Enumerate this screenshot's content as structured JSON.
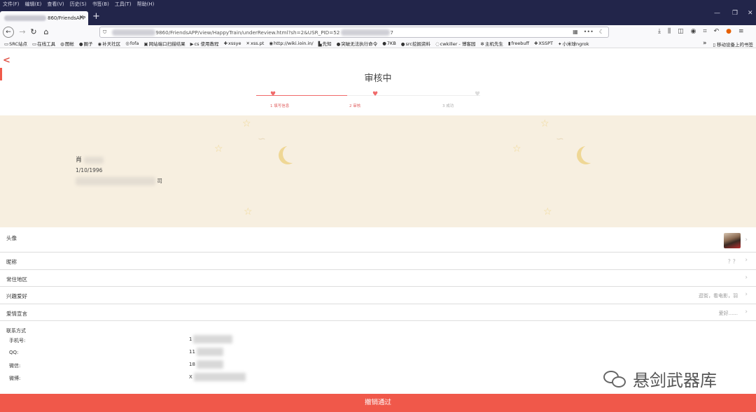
{
  "browser": {
    "menu": [
      "文件(F)",
      "编辑(E)",
      "查看(V)",
      "历史(S)",
      "书签(B)",
      "工具(T)",
      "帮助(H)"
    ],
    "tab_title": "860/FriendsAPP",
    "tab_close": "×",
    "new_tab": "+",
    "url_visible": "9860/FriendsAPP/view/HappyTrain/underReview.html?sh=2&USR_PID=52",
    "url_tail": "7",
    "bookmarks": [
      {
        "icon": "folder-icon",
        "glyph": "▭",
        "label": "SRC站点"
      },
      {
        "icon": "folder-icon",
        "glyph": "▭",
        "label": "在线工具"
      },
      {
        "icon": "globe-icon",
        "glyph": "◍",
        "label": "图帐"
      },
      {
        "icon": "site-icon",
        "glyph": "●",
        "label": "圈子"
      },
      {
        "icon": "site-icon",
        "glyph": "◉",
        "label": "补天社区"
      },
      {
        "icon": "site-icon",
        "glyph": "◎",
        "label": "fofa"
      },
      {
        "icon": "bookmark-icon",
        "glyph": "▣",
        "label": "网站端口扫描结果"
      },
      {
        "icon": "play-icon",
        "glyph": "▶",
        "label": "cs 使用教程"
      },
      {
        "icon": "bookmark-icon",
        "glyph": "✚",
        "label": "xssye"
      },
      {
        "icon": "bookmark-icon",
        "glyph": "✕",
        "label": "xss.pt"
      },
      {
        "icon": "site-icon",
        "glyph": "◉",
        "label": "http://wiki.ioin.in/"
      },
      {
        "icon": "site-icon",
        "glyph": "▙",
        "label": "先知"
      },
      {
        "icon": "github-icon",
        "glyph": "●",
        "label": "突破无法执行命令"
      },
      {
        "icon": "github-icon",
        "glyph": "●",
        "label": "7KB"
      },
      {
        "icon": "github-icon",
        "glyph": "●",
        "label": "src挖掘资料"
      },
      {
        "icon": "site-icon",
        "glyph": "◌",
        "label": "cwkiller - 博客园"
      },
      {
        "icon": "site-icon",
        "glyph": "✻",
        "label": "主机先生"
      },
      {
        "icon": "site-icon",
        "glyph": "▮",
        "label": "freebuff"
      },
      {
        "icon": "bookmark-icon",
        "glyph": "✚",
        "label": "XSSPT"
      },
      {
        "icon": "site-icon",
        "glyph": "✦",
        "label": "小米球ngrok"
      }
    ],
    "bookmarks_overflow": "»",
    "mobile_bookmarks": "▯ 移动设备上的书签"
  },
  "page": {
    "title": "审核中",
    "steps": [
      "1 填写信息",
      "2 审核",
      "3 成功"
    ],
    "profile": {
      "name_prefix": "肖",
      "dob": "1/10/1996",
      "address_suffix": "司"
    },
    "fields": [
      {
        "label": "头像",
        "value": ""
      },
      {
        "label": "昵称",
        "value": "？？"
      },
      {
        "label": "常住地区",
        "value": ""
      },
      {
        "label": "兴趣爱好",
        "value": "逛街，看电影，羽"
      },
      {
        "label": "爱情宣言",
        "value": "爱好......"
      }
    ],
    "contact_title": "联系方式",
    "contacts": [
      {
        "label": "手机号:",
        "value": "1"
      },
      {
        "label": "QQ:",
        "value": "11"
      },
      {
        "label": "微信:",
        "value": "18"
      },
      {
        "label": "微博:",
        "value": "X"
      }
    ],
    "watermark": "悬剑武器库",
    "revoke_button": "撤销通过"
  }
}
